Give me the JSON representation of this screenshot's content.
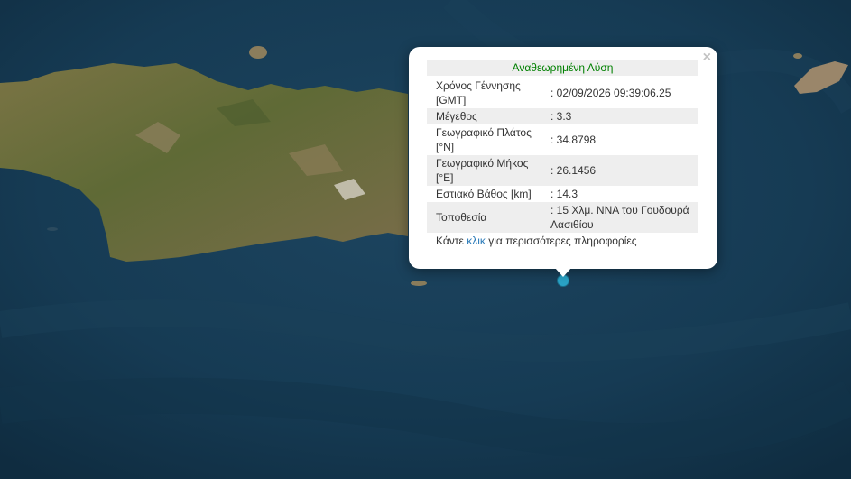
{
  "map": {
    "water_color": "#14344a",
    "land_color": "#6b6a3e"
  },
  "popup": {
    "title": "Αναθεωρημένη Λύση",
    "close_symbol": "×",
    "rows": [
      {
        "label": "Χρόνος Γέννησης [GMT]",
        "value": ": 02/09/2026 09:39:06.25"
      },
      {
        "label": "Μέγεθος",
        "value": ": 3.3"
      },
      {
        "label": "Γεωγραφικό Πλάτος [°N]",
        "value": ": 34.8798"
      },
      {
        "label": "Γεωγραφικό Μήκος [°E]",
        "value": ": 26.1456"
      },
      {
        "label": "Εστιακό Βάθος [km]",
        "value": ": 14.3"
      },
      {
        "label": "Τοποθεσία",
        "value": ": 15 Χλμ. ΝΝΑ του Γουδουρά Λασιθίου"
      }
    ],
    "more_prefix": "Κάντε",
    "more_link": "κλικ",
    "more_suffix": "για περισσότερες πληροφορίες"
  },
  "marker": {
    "icon": "earthquake-epicenter-marker",
    "color": "#2aa3c6"
  }
}
